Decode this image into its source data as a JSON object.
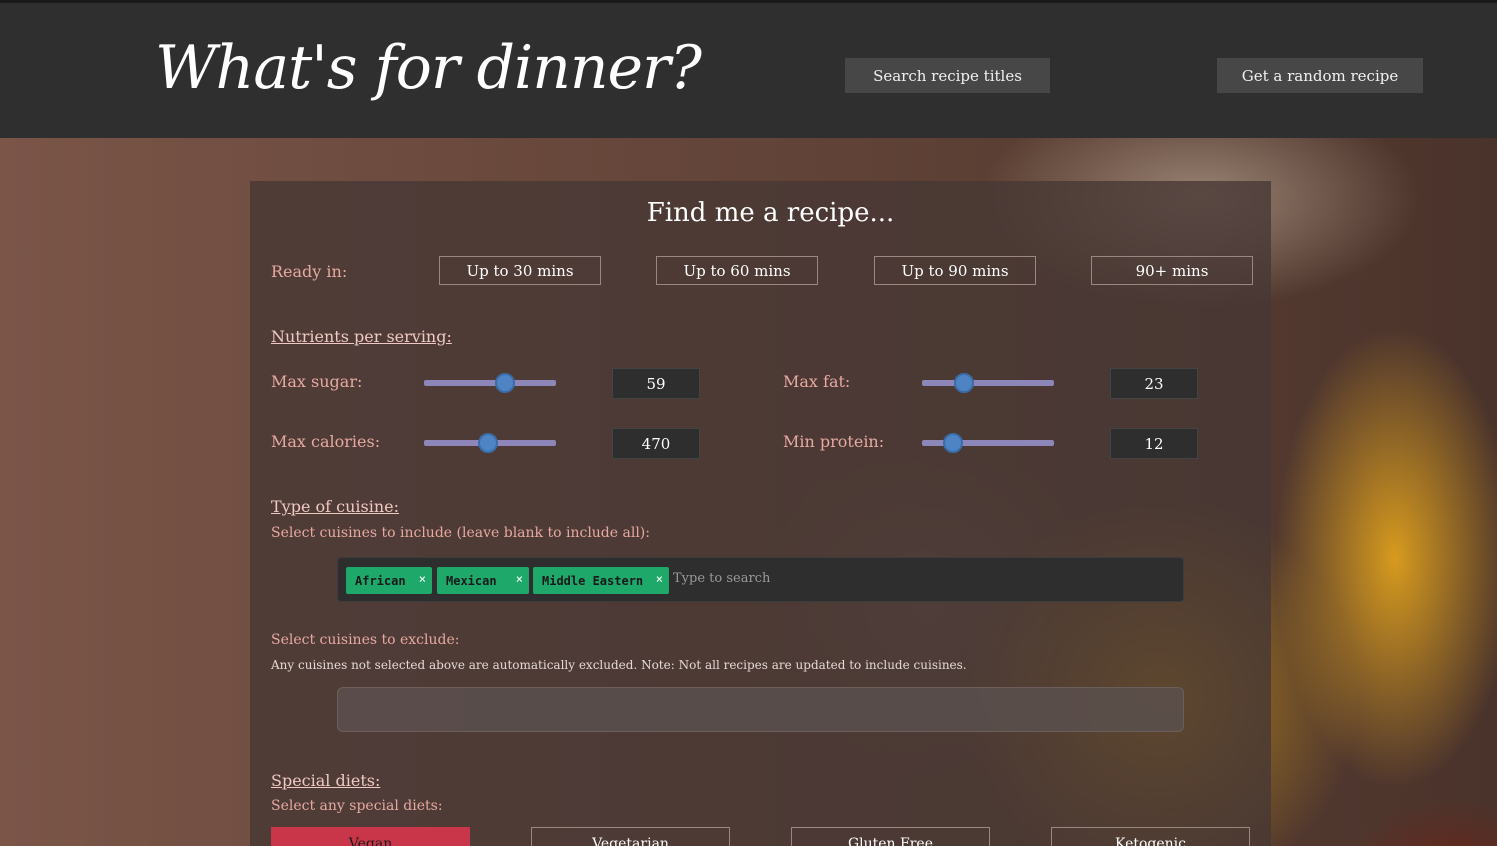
{
  "header": {
    "logo": "What's for dinner?",
    "search_label": "Search recipe titles",
    "random_label": "Get a random recipe"
  },
  "panel": {
    "title": "Find me a recipe...",
    "ready_label": "Ready in:",
    "times": [
      "Up to 30 mins",
      "Up to 60 mins",
      "Up to 90 mins",
      "90+ mins"
    ],
    "nutrients_heading": "Nutrients per serving:",
    "nutrients": [
      {
        "label": "Max sugar:",
        "value": "59",
        "fraction": 0.63
      },
      {
        "label": "Max fat:",
        "value": "23",
        "fraction": 0.29
      },
      {
        "label": "Max calories:",
        "value": "470",
        "fraction": 0.48
      },
      {
        "label": "Min protein:",
        "value": "12",
        "fraction": 0.19
      }
    ],
    "cuisine_heading": "Type of cuisine:",
    "include_label": "Select cuisines to include (leave blank to include all):",
    "included": [
      "African",
      "Mexican",
      "Middle Eastern"
    ],
    "tag_remove": "×",
    "search_placeholder": "Type to search",
    "exclude_label": "Select cuisines to exclude:",
    "exclude_note": "Any cuisines not selected above are automatically excluded. Note: Not all recipes are updated to include cuisines.",
    "diets_heading": "Special diets:",
    "diets_label": "Select any special diets:",
    "diets": [
      {
        "label": "Vegan",
        "active": true
      },
      {
        "label": "Vegetarian",
        "active": false
      },
      {
        "label": "Gluten Free",
        "active": false
      },
      {
        "label": "Ketogenic",
        "active": false
      }
    ]
  },
  "colors": {
    "accent_tag": "#1ea86a",
    "active_diet": "#c9364a",
    "slider_thumb": "#4e84c4"
  }
}
